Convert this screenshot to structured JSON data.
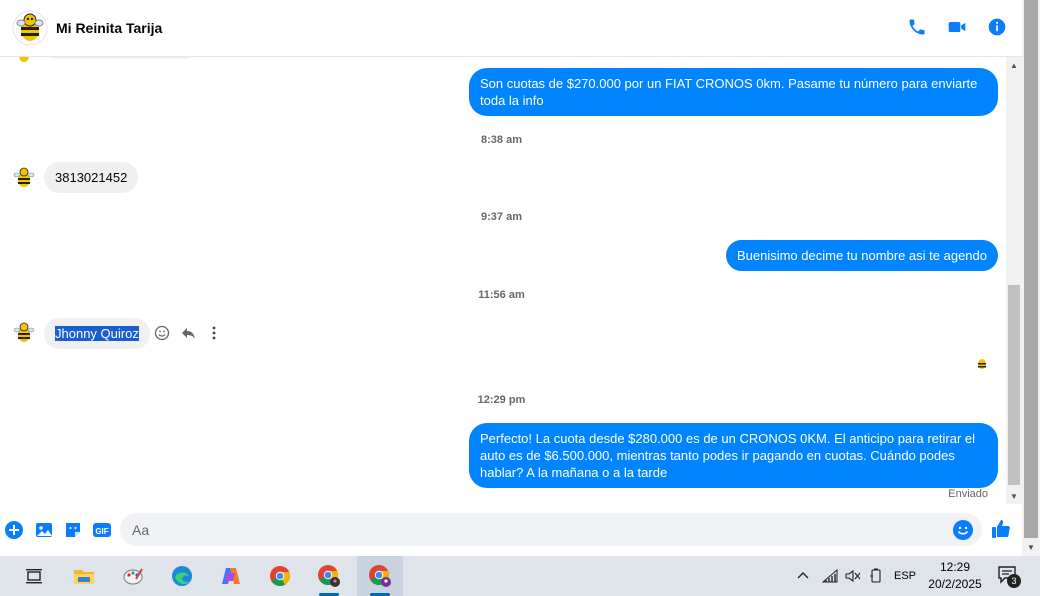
{
  "header": {
    "contact_name": "Mi Reinita Tarija",
    "call_icon": "phone-icon",
    "video_icon": "video-camera-icon",
    "info_icon": "info-icon",
    "accent": "#0a7cff"
  },
  "messages": [
    {
      "type": "outgoing",
      "text": "Son cuotas de $270.000 por un FIAT CRONOS 0km. Pasame tu número para enviarte toda la info"
    },
    {
      "type": "timestamp",
      "text": "8:38 am"
    },
    {
      "type": "incoming",
      "text": "3813021452"
    },
    {
      "type": "timestamp",
      "text": "9:37 am"
    },
    {
      "type": "outgoing",
      "text": "Buenisimo decime tu nombre asi te agendo"
    },
    {
      "type": "timestamp",
      "text": "11:56 am"
    },
    {
      "type": "incoming",
      "text": "Jhonny Quiroz",
      "selected": true
    },
    {
      "type": "timestamp",
      "text": "12:29 pm"
    },
    {
      "type": "outgoing",
      "text": "Perfecto! La cuota desde $280.000 es de un CRONOS 0KM. El anticipo para retirar el auto es de $6.500.000, mientras tanto podes ir pagando en cuotas. Cuándo podes hablar? A la mañana o a la tarde"
    }
  ],
  "message_status": "Enviado",
  "composer": {
    "placeholder": "Aa",
    "icons": [
      "plus-icon",
      "image-icon",
      "sticker-icon",
      "gif-icon",
      "emoji-icon",
      "thumbs-up-icon"
    ],
    "gif_label": "GIF"
  },
  "taskbar": {
    "apps": [
      "task-view-icon",
      "file-explorer-icon",
      "paint-icon",
      "edge-icon",
      "copilot-icon",
      "chrome-icon",
      "chrome-profile-icon",
      "chrome-profile-active-icon"
    ],
    "language": "ESP",
    "time": "12:29",
    "date": "20/2/2025",
    "notification_count": "3"
  }
}
